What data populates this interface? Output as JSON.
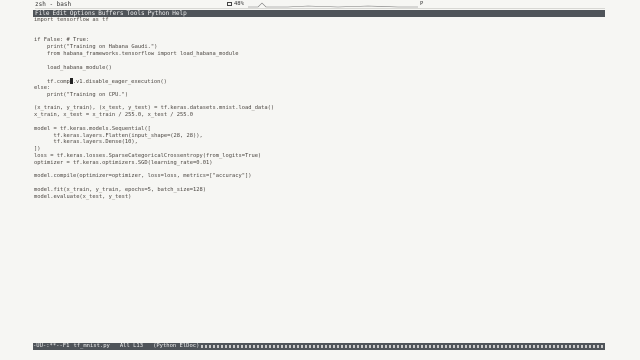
{
  "sysbar": {
    "title": "zsh - bash",
    "battery": "48%",
    "indicator": "P"
  },
  "menu": [
    "File",
    "Edit",
    "Options",
    "Buffers",
    "Tools",
    "Python",
    "Help"
  ],
  "code": [
    "import tensorflow as tf",
    "",
    "",
    "if False: # True:",
    "    print(\"Training on Habana Gaudi.\")",
    "    from habana_frameworks.tensorflow import load_habana_module",
    "",
    "    load_habana_module()",
    "",
    "    tf.compat.v1.disable_eager_execution()",
    "else:",
    "    print(\"Training on CPU.\")",
    "",
    "(x_train, y_train), (x_test, y_test) = tf.keras.datasets.mnist.load_data()",
    "x_train, x_test = x_train / 255.0, x_test / 255.0",
    "",
    "model = tf.keras.models.Sequential([",
    "      tf.keras.layers.Flatten(input_shape=(28, 28)),",
    "      tf.keras.layers.Dense(10),",
    "])",
    "loss = tf.keras.losses.SparseCategoricalCrossentropy(from_logits=True)",
    "optimizer = tf.keras.optimizers.SGD(learning_rate=0.01)",
    "",
    "model.compile(optimizer=optimizer, loss=loss, metrics=[\"accuracy\"])",
    "",
    "model.fit(x_train, y_train, epochs=5, batch_size=128)",
    "model.evaluate(x_test, y_test)"
  ],
  "cursor": {
    "line": 9,
    "before": "    tf.comp",
    "after": ".v1.disable_eager_execution()"
  },
  "modeline": {
    "status": "-UU-:**--F1",
    "filename": "tf_mnist.py",
    "position": "All L13",
    "mode": "(Python ElDoc)"
  }
}
